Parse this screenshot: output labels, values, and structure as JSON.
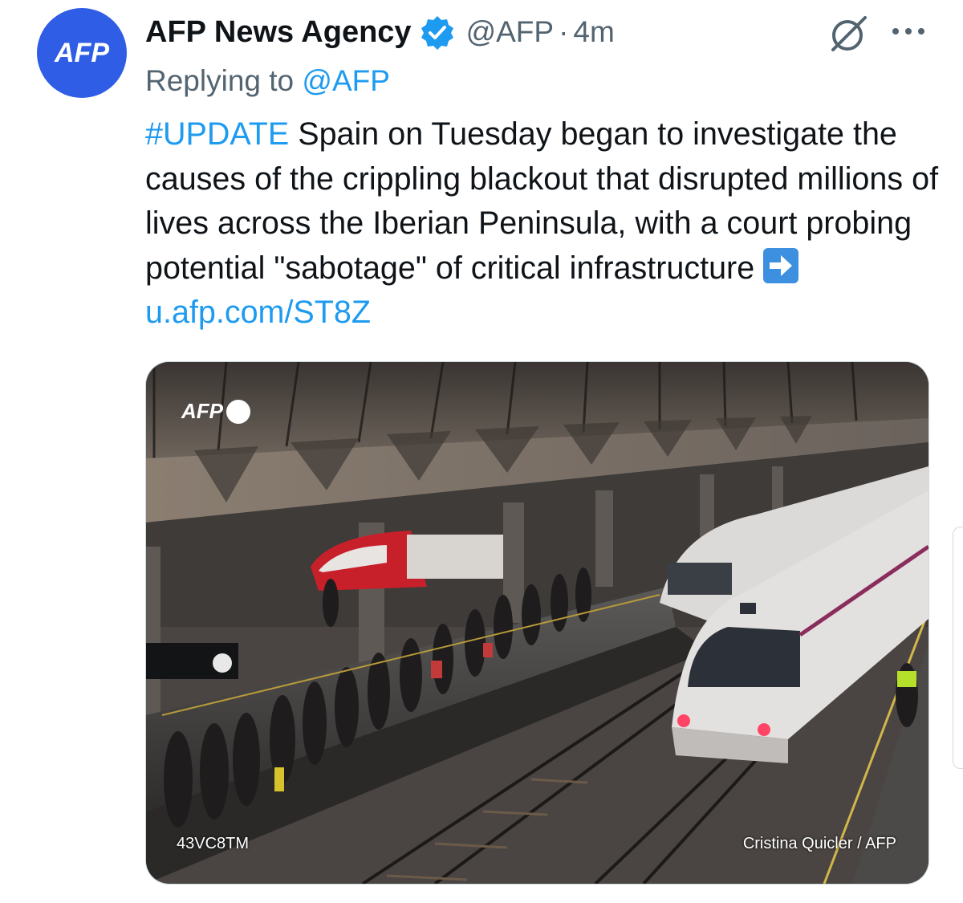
{
  "author": {
    "avatar_text": "AFP",
    "display_name": "AFP News Agency",
    "handle": "@AFP",
    "separator": "·",
    "time": "4m"
  },
  "reply": {
    "prefix": "Replying to",
    "mention": "@AFP"
  },
  "tweet": {
    "hashtag": "#UPDATE",
    "body": " Spain on Tuesday began to investigate the causes of the crippling blackout that disrupted millions of lives across the Iberian Peninsula, with a court probing potential \"sabotage\" of critical infrastructure ",
    "link": "u.afp.com/ST8Z"
  },
  "media": {
    "watermark": "AFP",
    "photo_id": "43VC8TM",
    "credit": "Cristina Quicler / AFP"
  },
  "icons": {
    "verified": "verified-badge-icon",
    "grok": "grok-icon",
    "more": "more-icon",
    "arrow": "right-arrow-emoji-icon"
  },
  "colors": {
    "link": "#1d9bf0",
    "secondary_text": "#536471",
    "avatar": "#2f5de6"
  }
}
